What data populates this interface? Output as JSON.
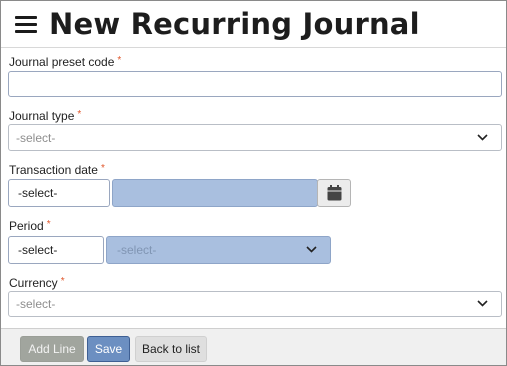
{
  "header": {
    "title": "New Recurring Journal"
  },
  "form": {
    "preset_code": {
      "label": "Journal preset code",
      "required_mark": "*",
      "value": ""
    },
    "journal_type": {
      "label": "Journal type",
      "required_mark": "*",
      "value": "-select-"
    },
    "transaction_date": {
      "label": "Transaction date",
      "required_mark": "*",
      "select_value": "-select-",
      "date_value": ""
    },
    "period": {
      "label": "Period",
      "required_mark": "*",
      "first_value": "-select-",
      "second_value": "-select-"
    },
    "currency": {
      "label": "Currency",
      "required_mark": "*",
      "value": "-select-"
    }
  },
  "footer": {
    "add_line_label": "Add Line",
    "save_label": "Save",
    "back_label": "Back to list"
  },
  "icons": {
    "menu": "hamburger-menu-icon",
    "dropdown": "chevron-down-icon",
    "calendar": "calendar-icon"
  }
}
